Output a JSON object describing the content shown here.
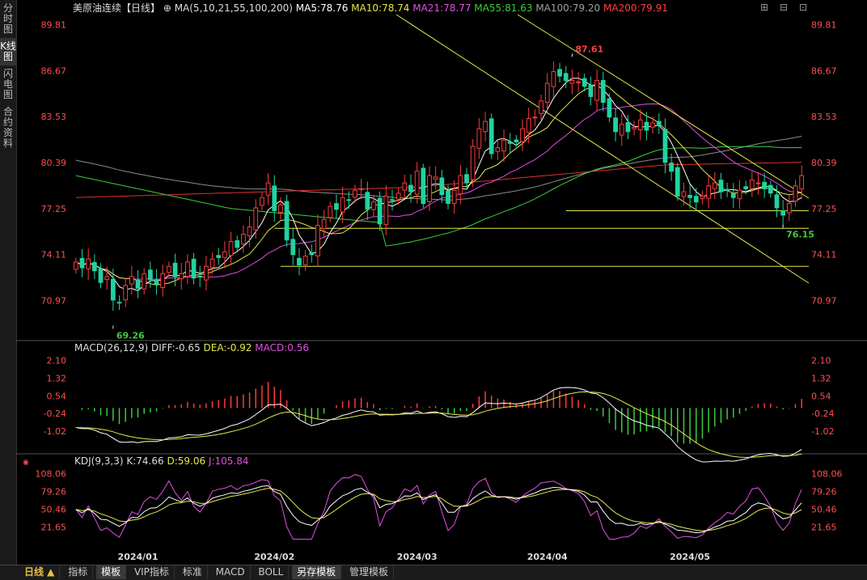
{
  "sidebar": {
    "tabs": [
      "分时图",
      "K线图",
      "闪电图",
      "合约资料"
    ],
    "active": 1
  },
  "header": {
    "title": "美原油连续【日线】",
    "ma_params": "MA(5,10,21,55,100,200)",
    "ma_items": [
      {
        "label": "MA5:78.76",
        "color": "#ffffff"
      },
      {
        "label": "MA10:78.74",
        "color": "#e8e84a"
      },
      {
        "label": "MA21:78.77",
        "color": "#e050e0"
      },
      {
        "label": "MA55:81.63",
        "color": "#3ccc3c"
      },
      {
        "label": "MA100:79.20",
        "color": "#a0a0a0"
      },
      {
        "label": "MA200:79.91",
        "color": "#ff4040"
      }
    ]
  },
  "macd_header": {
    "name": "MACD(26,12,9)",
    "diff": "DIFF:-0.65",
    "dea": "DEA:-0.92",
    "macd": "MACD:0.56"
  },
  "kdj_header": {
    "name": "KDJ(9,3,3)",
    "k": "K:74.66",
    "d": "D:59.06",
    "j": "J:105.84"
  },
  "bottom": {
    "period_label": "日线 ▲",
    "tabs": [
      "指标",
      "模板",
      "VIP指标",
      "标准",
      "MACD",
      "BOLL",
      "另存模板",
      "管理模板"
    ],
    "active_tabs": [
      1,
      6
    ]
  },
  "chart_data": {
    "type": "candlestick",
    "price_axis_ticks": [
      "89.81",
      "86.67",
      "83.53",
      "80.39",
      "77.25",
      "74.11",
      "70.97"
    ],
    "price_ylim": [
      68.4,
      90.5
    ],
    "macd_axis_ticks": [
      "2.10",
      "1.32",
      "0.54",
      "-0.24",
      "-1.02"
    ],
    "kdj_axis_ticks": [
      "108.06",
      "79.26",
      "50.46",
      "21.65"
    ],
    "x_labels": [
      {
        "label": "2024/01",
        "index": 10
      },
      {
        "label": "2024/02",
        "index": 32
      },
      {
        "label": "2024/03",
        "index": 55
      },
      {
        "label": "2024/04",
        "index": 76
      },
      {
        "label": "2024/05",
        "index": 99
      }
    ],
    "annotations": [
      {
        "label": "87.61",
        "index": 80,
        "price": 87.61,
        "color": "#ff4040"
      },
      {
        "label": "69.26",
        "index": 6,
        "price": 69.26,
        "color": "#3ccc3c"
      },
      {
        "label": "76.15",
        "index": 114,
        "price": 76.15,
        "color": "#3ccc3c"
      }
    ],
    "closes": [
      73.6,
      73.2,
      73.8,
      73.0,
      72.2,
      72.6,
      71.0,
      70.8,
      72.0,
      72.6,
      71.8,
      72.8,
      72.4,
      72.1,
      72.8,
      73.3,
      72.6,
      72.8,
      73.6,
      72.5,
      72.6,
      73.3,
      73.8,
      73.9,
      74.3,
      75.0,
      74.6,
      75.5,
      76.0,
      77.3,
      78.0,
      79.0,
      77.1,
      77.5,
      75.1,
      74.1,
      73.4,
      74.0,
      74.1,
      76.1,
      76.5,
      77.4,
      77.2,
      78.0,
      77.8,
      78.5,
      78.6,
      77.2,
      77.7,
      76.2,
      78.1,
      77.8,
      78.3,
      79.0,
      78.4,
      79.8,
      77.6,
      79.5,
      79.4,
      78.2,
      77.6,
      78.5,
      79.5,
      79.0,
      81.5,
      82.7,
      83.2,
      81.0,
      81.4,
      81.9,
      81.7,
      81.8,
      82.7,
      83.4,
      83.5,
      84.6,
      85.8,
      86.6,
      86.3,
      86.0,
      86.0,
      85.9,
      85.6,
      84.9,
      86.0,
      84.5,
      83.5,
      82.5,
      83.0,
      82.5,
      82.8,
      83.3,
      82.6,
      83.1,
      82.9,
      80.4,
      79.8,
      78.1,
      78.4,
      78.0,
      77.7,
      78.1,
      78.8,
      79.0,
      78.4,
      78.5,
      78.0,
      78.5,
      78.6,
      79.2,
      79.0,
      78.6,
      78.3,
      77.3,
      76.8,
      77.6,
      78.8,
      79.5
    ]
  }
}
